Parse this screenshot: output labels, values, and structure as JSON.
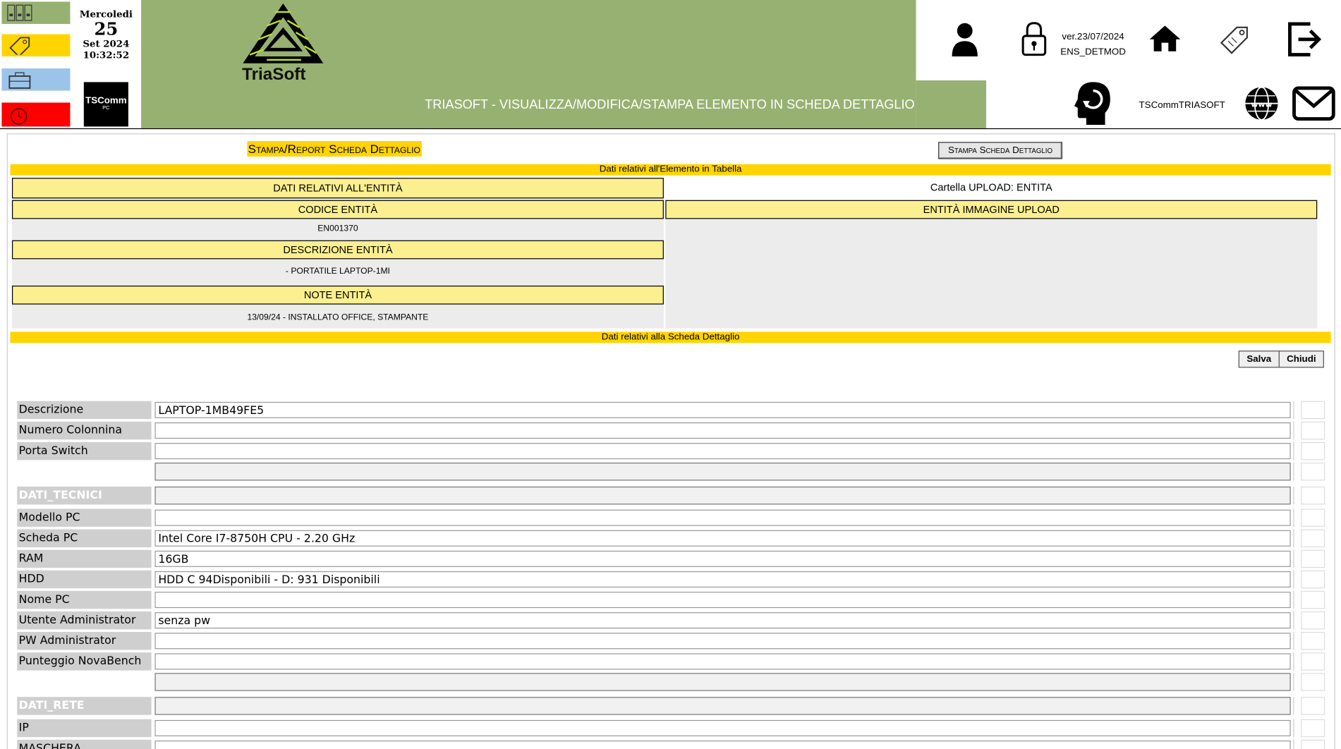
{
  "header": {
    "date_dow": "Mercoledi",
    "date_day": "25",
    "date_month_year": "Set 2024",
    "time": "10:32:52",
    "tscomm_badge_line1": "TSComm",
    "tscomm_badge_line2": "PC",
    "logo_text": "TriaSoft",
    "page_title": "TRIASOFT - VISUALIZZA/MODIFICA/STAMPA ELEMENTO IN SCHEDA DETTAGLIO",
    "version": "ver.23/07/2024",
    "module": "ENS_DETMOD",
    "tscomm_name": "TSCommTRIASOFT"
  },
  "colors": {
    "header_green": "#97b172",
    "gold": "#ffd400",
    "label_yellow": "#fbef8f",
    "nav_yellow": "#ffd400",
    "nav_blue": "#9cc4ea",
    "nav_red": "#ff0000",
    "nav_green": "#97b172"
  },
  "toolbar": {
    "stampa_title": "Stampa/Report Scheda Dettaglio",
    "stampa_button": "Stampa Scheda Dettaglio",
    "save_label": "Salva",
    "close_label": "Chiudi"
  },
  "section1": {
    "bar": "Dati relativi all'Elemento in Tabella",
    "dati_entita": "DATI RELATIVI ALL'ENTITÀ",
    "codice_label": "CODICE ENTITÀ",
    "codice_value": "EN001370",
    "descrizione_label": "DESCRIZIONE ENTITÀ",
    "descrizione_value": "- PORTATILE LAPTOP-1MI",
    "note_label": "NOTE ENTITÀ",
    "note_value": "13/09/24 - INSTALLATO OFFICE, STAMPANTE",
    "cartella": "Cartella UPLOAD: ENTITA",
    "immagine_label": "ENTITÀ IMMAGINE UPLOAD"
  },
  "section2": {
    "bar": "Dati relativi alla Scheda Dettaglio"
  },
  "form": {
    "rows": [
      {
        "label": "Descrizione",
        "value": "LAPTOP-1MB49FE5"
      },
      {
        "label": "Numero Colonnina",
        "value": ""
      },
      {
        "label": "Porta Switch",
        "value": ""
      },
      {
        "label": "",
        "value": ""
      },
      {
        "label": "DATI_TECNICI",
        "value": ""
      },
      {
        "label": "Modello PC",
        "value": ""
      },
      {
        "label": "Scheda PC",
        "value": "Intel Core I7-8750H CPU - 2.20 GHz"
      },
      {
        "label": "RAM",
        "value": "16GB"
      },
      {
        "label": "HDD",
        "value": "HDD C 94Disponibili - D: 931 Disponibili"
      },
      {
        "label": "Nome PC",
        "value": ""
      },
      {
        "label": "Utente Administrator",
        "value": "senza pw"
      },
      {
        "label": "PW Administrator",
        "value": ""
      },
      {
        "label": "Punteggio NovaBench",
        "value": ""
      },
      {
        "label": "",
        "value": ""
      },
      {
        "label": "DATI_RETE",
        "value": ""
      },
      {
        "label": "IP",
        "value": ""
      },
      {
        "label": "MASCHERA",
        "value": ""
      }
    ]
  }
}
